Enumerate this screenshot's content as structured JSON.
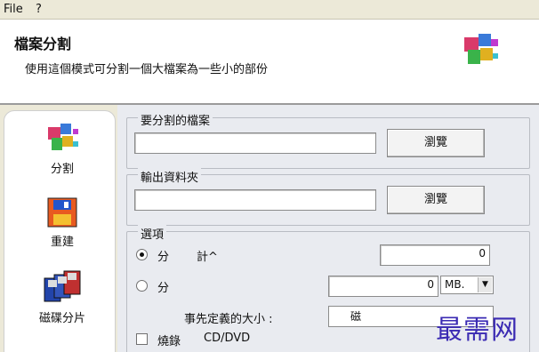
{
  "menu": {
    "file": "File",
    "help": "?"
  },
  "header": {
    "title": "檔案分割",
    "description": "使用這個模式可分割一個大檔案為一些小的部份"
  },
  "sidebar": {
    "items": [
      {
        "label": "分割",
        "icon": "cube-icon"
      },
      {
        "label": "重建",
        "icon": "floppy-icon"
      },
      {
        "label": "磁碟分片",
        "icon": "disks-icon"
      }
    ]
  },
  "split_file": {
    "legend": "要分割的檔案",
    "value": "",
    "browse_label": "瀏覽"
  },
  "output_folder": {
    "legend": "輸出資料夾",
    "value": "",
    "browse_label": "瀏覽"
  },
  "options": {
    "legend": "選項",
    "option1_label": "分",
    "option1_suffix": "計^",
    "option1_value": "0",
    "option2_label": "分",
    "option2_value": "0",
    "option2_unit": "MB.",
    "predefined_label": "事先定義的大小 :",
    "predefined_value": "磁",
    "checkbox_label": "燒錄",
    "checkbox_suffix": "CD/DVD"
  },
  "watermark": {
    "text": "最需网"
  },
  "colors": {
    "panel_bg": "#e9ebf0",
    "menu_bg": "#ece9d8",
    "watermark": "#3b2bb3"
  }
}
